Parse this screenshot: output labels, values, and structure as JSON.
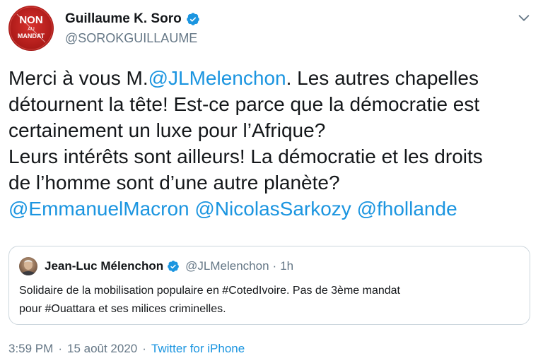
{
  "author": {
    "display_name": "Guillaume K. Soro",
    "handle": "@SOROKGUILLAUME",
    "avatar_text": [
      "NON",
      "AU",
      "MANDAT"
    ],
    "verified": true
  },
  "tweet": {
    "lines": [
      [
        {
          "t": "Merci à vous M.",
          "k": "text"
        },
        {
          "t": "@JLMelenchon",
          "k": "mention"
        },
        {
          "t": ". Les autres chapelles",
          "k": "text"
        }
      ],
      [
        {
          "t": "détournent la tête! Est-ce parce que la démocratie est",
          "k": "text"
        }
      ],
      [
        {
          "t": "certainement un luxe pour l’Afrique?",
          "k": "text"
        }
      ],
      [
        {
          "t": "Leurs intérêts sont ailleurs! La démocratie et les droits",
          "k": "text"
        }
      ],
      [
        {
          "t": "de l’homme sont d’une autre planète?",
          "k": "text"
        }
      ],
      [
        {
          "t": "@EmmanuelMacron",
          "k": "mention"
        },
        {
          "t": " ",
          "k": "text"
        },
        {
          "t": "@NicolasSarkozy",
          "k": "mention"
        },
        {
          "t": " ",
          "k": "text"
        },
        {
          "t": "@fhollande",
          "k": "mention"
        }
      ]
    ]
  },
  "quoted": {
    "display_name": "Jean-Luc Mélenchon",
    "handle": "@JLMelenchon",
    "separator": "·",
    "time": "1h",
    "verified": true,
    "lines": [
      "Solidaire de la mobilisation populaire en #CotedIvoire. Pas de 3ème mandat",
      "pour #Ouattara et ses milices criminelles."
    ]
  },
  "meta": {
    "time": "3:59 PM",
    "separator": "·",
    "date": "15 août 2020",
    "source": "Twitter for iPhone"
  },
  "colors": {
    "accent": "#1b95e0",
    "text": "#14171a",
    "secondary": "#657786",
    "border": "#ccd6dd",
    "avatar_red": "#c8241f"
  },
  "icons": {
    "verified": "verified-badge-icon",
    "menu": "chevron-down-icon"
  }
}
